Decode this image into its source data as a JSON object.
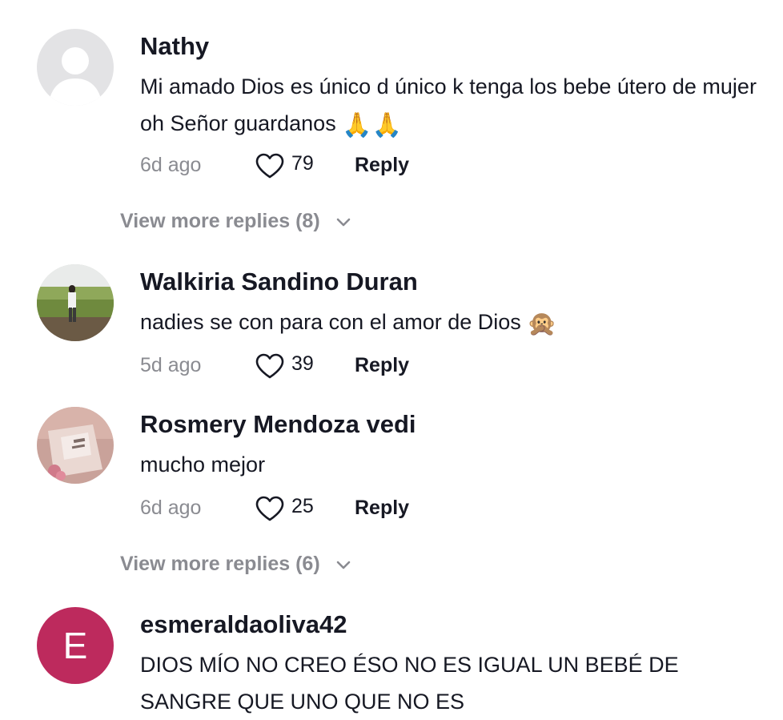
{
  "comments": [
    {
      "username": "Nathy",
      "text": "Mi amado Dios es único d único k tenga los bebe útero de mujer oh Señor guardanos",
      "emoji": "🙏🙏",
      "time": "6d ago",
      "likes": "79",
      "reply_label": "Reply",
      "avatar_icon": "default-avatar-icon"
    },
    {
      "username": "Walkiria Sandino Duran",
      "text": "nadies se con para con el amor de Dios",
      "emoji": "🙊",
      "time": "5d ago",
      "likes": "39",
      "reply_label": "Reply",
      "avatar_icon": "photo-avatar-icon"
    },
    {
      "username": "Rosmery Mendoza vedi",
      "text": "mucho mejor",
      "time": "6d ago",
      "likes": "25",
      "reply_label": "Reply",
      "avatar_icon": "photo-avatar-icon"
    },
    {
      "username": "esmeraldaoliva42",
      "text": "DIOS MÍO NO CREO ÉSO NO ES IGUAL UN BEBÉ DE SANGRE QUE UNO QUE NO ES",
      "avatar_letter": "E",
      "avatar_color": "#bd2a5d"
    }
  ],
  "view_more": [
    {
      "label": "View more replies (8)"
    },
    {
      "label": "View more replies (6)"
    }
  ],
  "colors": {
    "primary_text": "#161823",
    "secondary_text": "#8a8b91",
    "background": "#ffffff"
  }
}
